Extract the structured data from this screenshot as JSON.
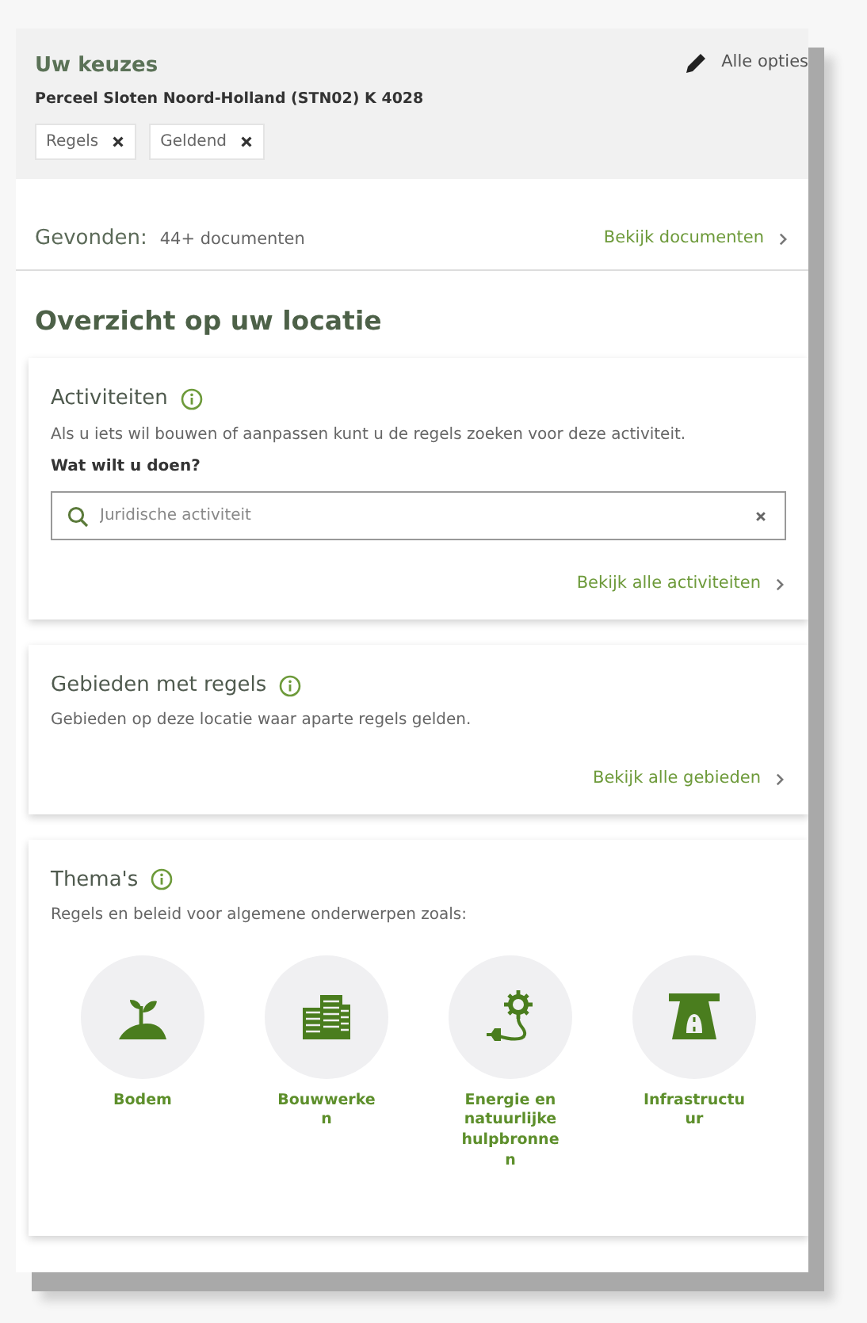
{
  "choices": {
    "title": "Uw keuzes",
    "edit_link": "Alle opties",
    "location": "Perceel Sloten Noord-Holland (STN02) K 4028",
    "filters": [
      {
        "label": "Regels"
      },
      {
        "label": "Geldend"
      }
    ]
  },
  "found": {
    "label": "Gevonden:",
    "count": "44+ documenten",
    "link": "Bekijk documenten"
  },
  "overview_title": "Overzicht op uw locatie",
  "sections": [
    {
      "kind": "search",
      "title": "Activiteiten",
      "description": "Als u iets wil bouwen of aanpassen kunt u de regels zoeken voor deze activiteit.",
      "question": "Wat wilt u doen?",
      "placeholder": "Juridische activiteit",
      "link": "Bekijk alle activiteiten"
    },
    {
      "kind": "plain",
      "title": "Gebieden met regels",
      "description": "Gebieden op deze locatie waar aparte regels gelden.",
      "link": "Bekijk alle gebieden"
    },
    {
      "kind": "themes",
      "title": "Thema's",
      "description": "Regels en beleid voor algemene onderwerpen zoals:",
      "themes": [
        {
          "label": "Bodem",
          "kind": "soil"
        },
        {
          "label": "Bouwwerken",
          "kind": "building"
        },
        {
          "label": "Energie en natuurlijke hulpbronnen",
          "kind": "energy"
        },
        {
          "label": "Infrastructuur",
          "kind": "road"
        }
      ]
    }
  ]
}
